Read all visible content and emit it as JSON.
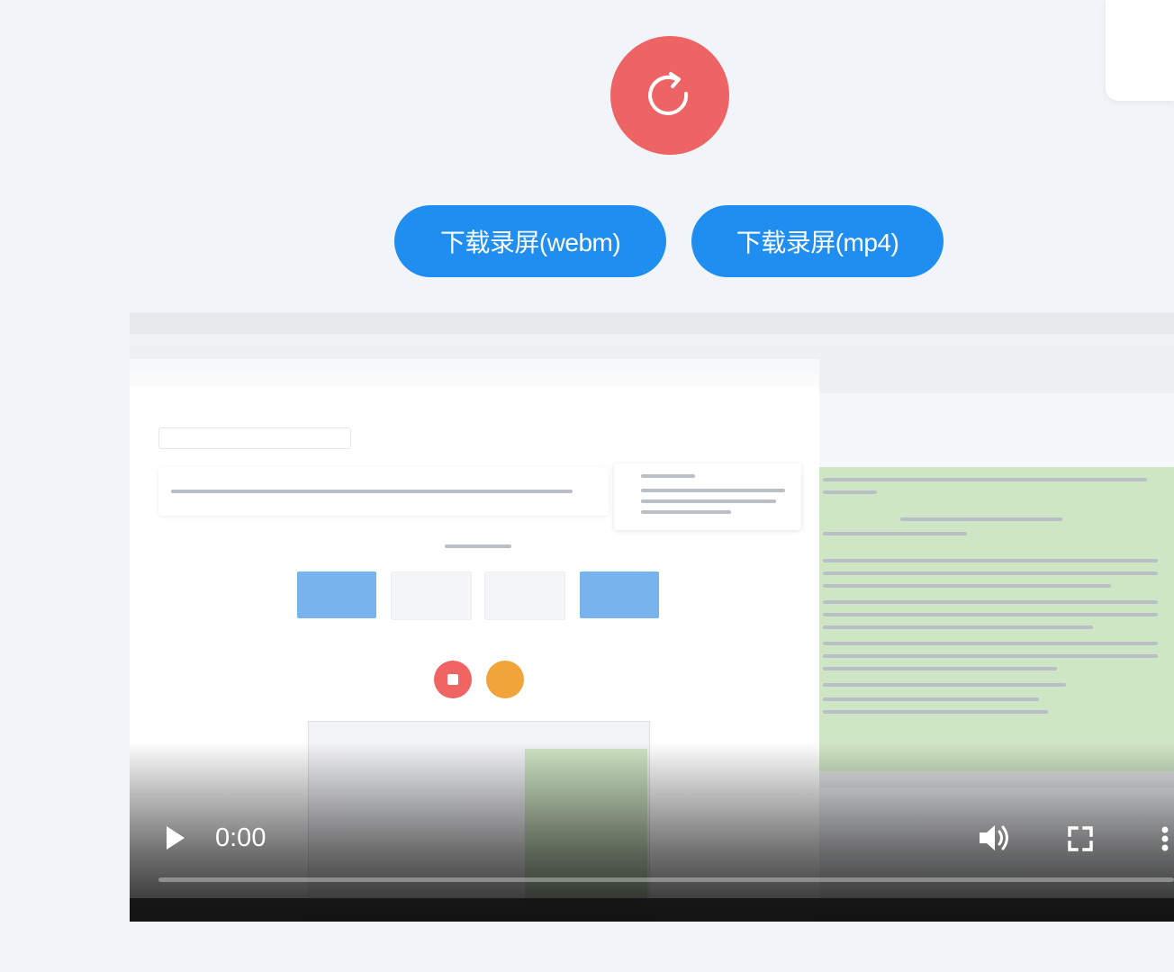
{
  "reload": {
    "icon": "reload-icon"
  },
  "downloads": {
    "webm_label": "下载录屏(webm)",
    "mp4_label": "下载录屏(mp4)"
  },
  "player": {
    "current_time": "0:00",
    "progress": 0,
    "icons": {
      "play": "play-icon",
      "volume": "volume-icon",
      "fullscreen": "fullscreen-icon",
      "more": "more-vertical-icon"
    }
  },
  "colors": {
    "reload_button": "#ee6363",
    "download_button": "#1f8ef0",
    "background": "#f1f4f9"
  }
}
